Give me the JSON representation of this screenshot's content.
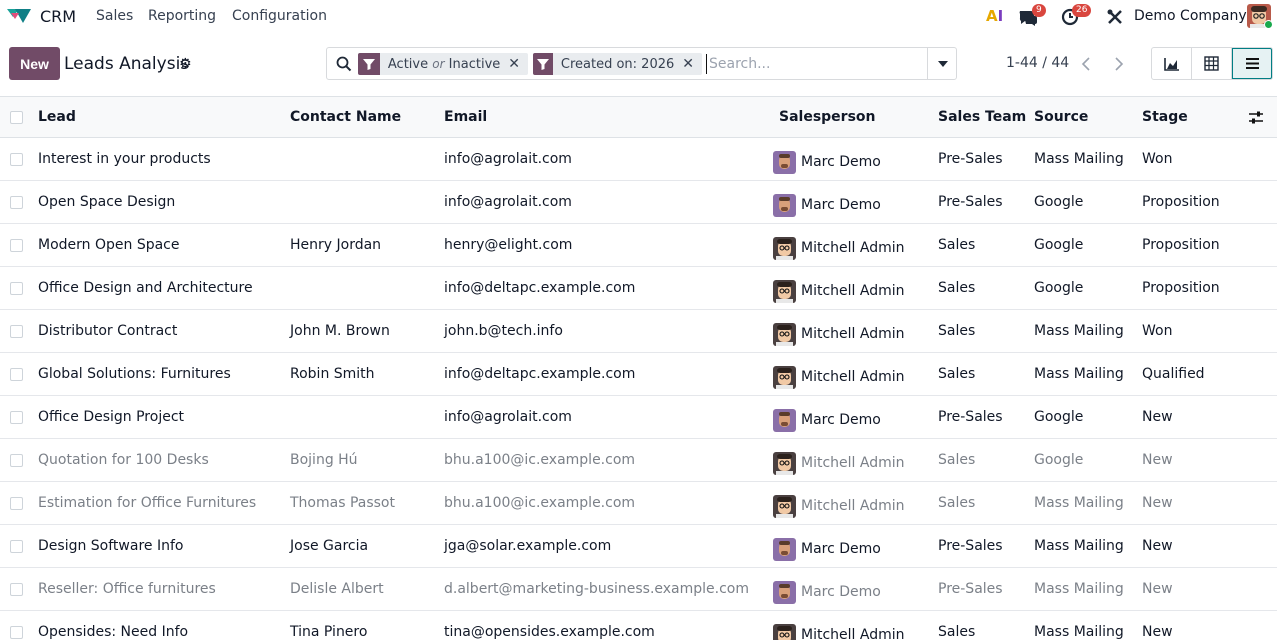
{
  "app": {
    "name": "CRM",
    "menus": [
      "Sales",
      "Reporting",
      "Configuration"
    ]
  },
  "systray": {
    "ai_label_1": "A",
    "ai_label_2": "I",
    "messages_count": "9",
    "activities_count": "26",
    "company": "Demo Company"
  },
  "control": {
    "new_label": "New",
    "title": "Leads Analysis",
    "facets": [
      {
        "part1": "Active",
        "or": "or",
        "part2": "Inactive"
      },
      {
        "label": "Created on: 2026"
      }
    ],
    "search_placeholder": "Search...",
    "pager": "1-44 / 44"
  },
  "colors": {
    "brand": "#714B67",
    "accent": "#017e84"
  },
  "table": {
    "columns": [
      "Lead",
      "Contact Name",
      "Email",
      "Salesperson",
      "Sales Team",
      "Source",
      "Stage"
    ],
    "rows": [
      {
        "lead": "Interest in your products",
        "contact": "",
        "email": "info@agrolait.com",
        "salesperson": "Marc Demo",
        "team": "Pre-Sales",
        "source": "Mass Mailing",
        "stage": "Won"
      },
      {
        "lead": "Open Space Design",
        "contact": "",
        "email": "info@agrolait.com",
        "salesperson": "Marc Demo",
        "team": "Pre-Sales",
        "source": "Google",
        "stage": "Proposition"
      },
      {
        "lead": "Modern Open Space",
        "contact": "Henry Jordan",
        "email": "henry@elight.com",
        "salesperson": "Mitchell Admin",
        "team": "Sales",
        "source": "Google",
        "stage": "Proposition"
      },
      {
        "lead": "Office Design and Architecture",
        "contact": "",
        "email": "info@deltapc.example.com",
        "salesperson": "Mitchell Admin",
        "team": "Sales",
        "source": "Google",
        "stage": "Proposition"
      },
      {
        "lead": "Distributor Contract",
        "contact": "John M. Brown",
        "email": "john.b@tech.info",
        "salesperson": "Mitchell Admin",
        "team": "Sales",
        "source": "Mass Mailing",
        "stage": "Won"
      },
      {
        "lead": "Global Solutions: Furnitures",
        "contact": "Robin Smith",
        "email": "info@deltapc.example.com",
        "salesperson": "Mitchell Admin",
        "team": "Sales",
        "source": "Mass Mailing",
        "stage": "Qualified"
      },
      {
        "lead": "Office Design Project",
        "contact": "",
        "email": "info@agrolait.com",
        "salesperson": "Marc Demo",
        "team": "Pre-Sales",
        "source": "Google",
        "stage": "New"
      },
      {
        "lead": "Quotation for 100 Desks",
        "contact": "Bojing Hú",
        "email": "bhu.a100@ic.example.com",
        "salesperson": "Mitchell Admin",
        "team": "Sales",
        "source": "Google",
        "stage": "New",
        "muted": true
      },
      {
        "lead": "Estimation for Office Furnitures",
        "contact": "Thomas Passot",
        "email": "bhu.a100@ic.example.com",
        "salesperson": "Mitchell Admin",
        "team": "Sales",
        "source": "Mass Mailing",
        "stage": "New",
        "muted": true
      },
      {
        "lead": "Design Software Info",
        "contact": "Jose Garcia",
        "email": "jga@solar.example.com",
        "salesperson": "Marc Demo",
        "team": "Pre-Sales",
        "source": "Mass Mailing",
        "stage": "New"
      },
      {
        "lead": "Reseller: Office furnitures",
        "contact": "Delisle Albert",
        "email": "d.albert@marketing-business.example.com",
        "salesperson": "Marc Demo",
        "team": "Pre-Sales",
        "source": "Mass Mailing",
        "stage": "New",
        "muted": true
      },
      {
        "lead": "Opensides: Need Info",
        "contact": "Tina Pinero",
        "email": "tina@opensides.example.com",
        "salesperson": "Mitchell Admin",
        "team": "Sales",
        "source": "Mass Mailing",
        "stage": "New"
      }
    ]
  }
}
